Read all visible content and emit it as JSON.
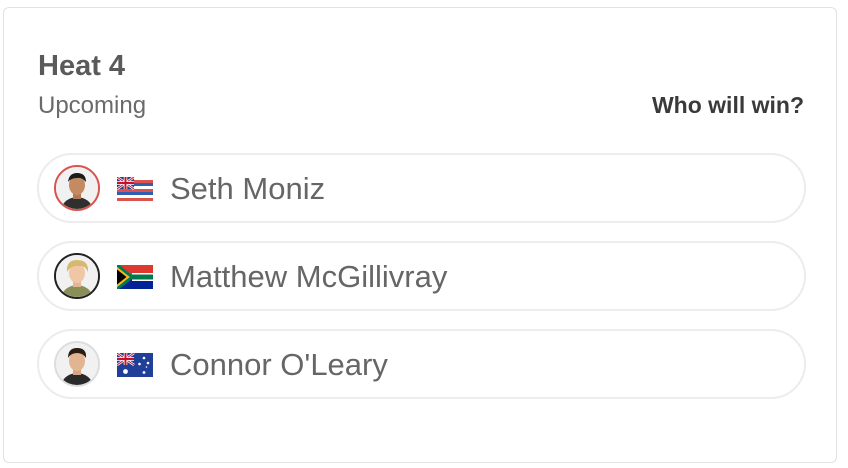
{
  "heat": {
    "title": "Heat 4",
    "status": "Upcoming",
    "prompt": "Who will win?"
  },
  "surfers": [
    {
      "name": "Seth Moniz",
      "flag": "hawaii-flag-icon",
      "ring_color": "#d9534f"
    },
    {
      "name": "Matthew McGillivray",
      "flag": "south-africa-flag-icon",
      "ring_color": "#222222"
    },
    {
      "name": "Connor O'Leary",
      "flag": "australia-flag-icon",
      "ring_color": "#dddddd"
    }
  ]
}
